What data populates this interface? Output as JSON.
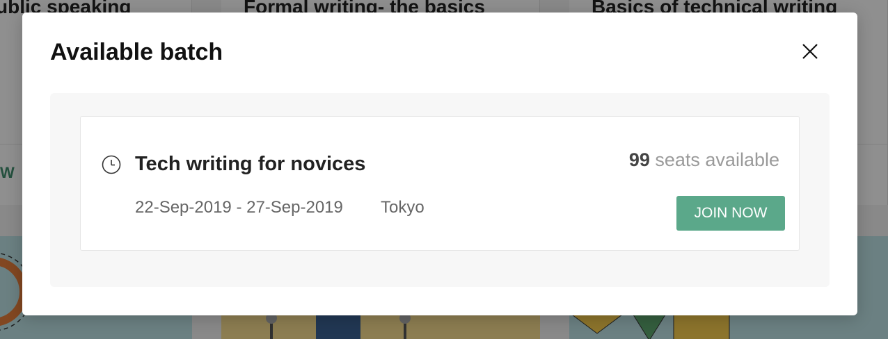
{
  "background": {
    "cards": [
      {
        "title": "ublic speaking"
      },
      {
        "title": "Formal writing- the basics"
      },
      {
        "title": "Basics of technical writing"
      }
    ],
    "link_fragment": "W",
    "colors": {
      "teal_image": "#b9dde0",
      "yellow_image": "#f2d88c",
      "link": "#3f8a6c"
    }
  },
  "modal": {
    "title": "Available batch",
    "close_icon": "close-icon",
    "batch": {
      "icon": "clock-icon",
      "name": "Tech writing for novices",
      "dates": "22-Sep-2019 - 27-Sep-2019",
      "location": "Tokyo",
      "seat_count": "99",
      "seats_label": "seats available",
      "join_label": "JOIN NOW"
    },
    "colors": {
      "accent": "#5ba88a"
    }
  }
}
